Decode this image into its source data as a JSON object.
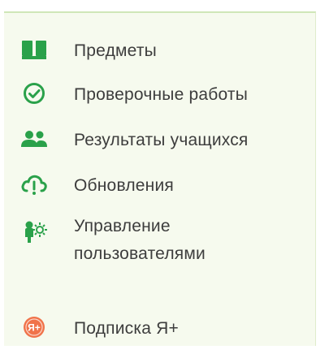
{
  "colors": {
    "accent": "#2aa14a",
    "subscription": "#f0734a",
    "text": "#3d3d3d",
    "panel_background": "#f6faee"
  },
  "menu": {
    "items": [
      {
        "label": "Предметы",
        "icon": "book-icon"
      },
      {
        "label": "Проверочные работы",
        "icon": "check-circle-icon"
      },
      {
        "label": "Результаты учащихся",
        "icon": "students-icon"
      },
      {
        "label": "Обновления",
        "icon": "cloud-update-icon"
      },
      {
        "label": "Управление пользователями",
        "icon": "user-settings-icon"
      },
      {
        "label": "Подписка Я+",
        "icon": "subscription-badge-icon",
        "badge_text": "Я+"
      }
    ]
  }
}
